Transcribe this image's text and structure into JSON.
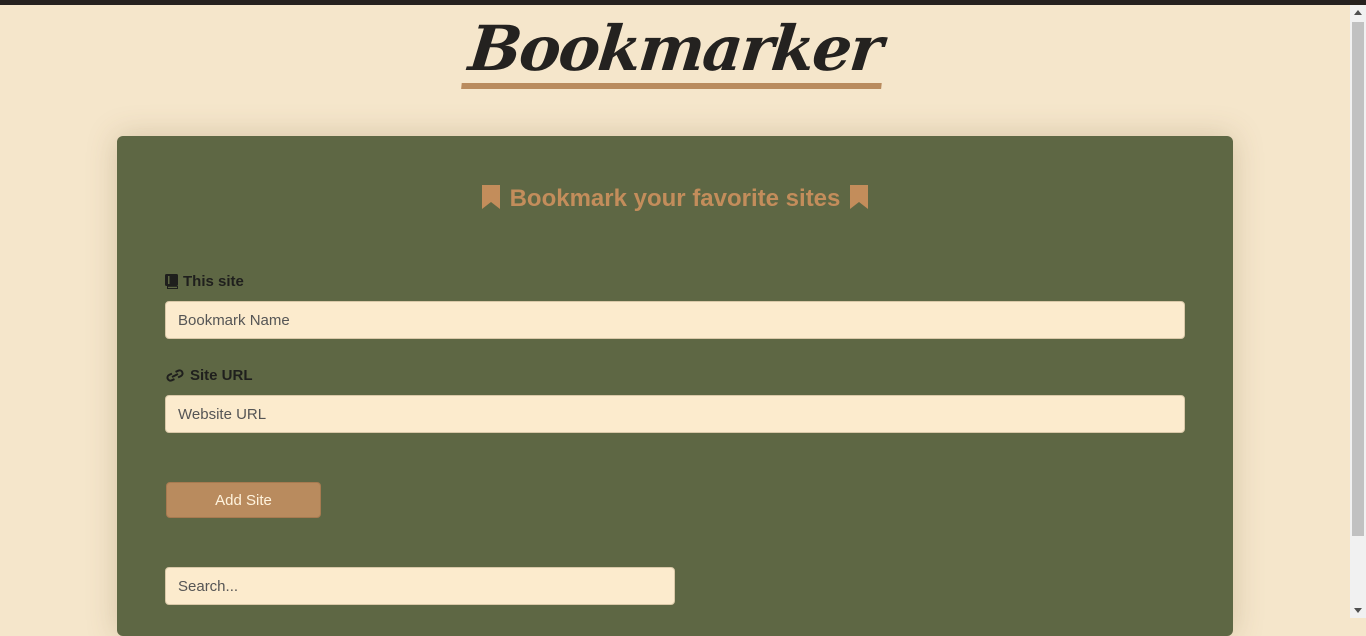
{
  "header": {
    "title": "Bookmarker"
  },
  "card": {
    "heading": "Bookmark your favorite sites",
    "name_field": {
      "label": "This site",
      "placeholder": "Bookmark Name",
      "value": ""
    },
    "url_field": {
      "label": "Site URL",
      "placeholder": "Website URL",
      "value": ""
    },
    "add_button_label": "Add Site",
    "search": {
      "placeholder": "Search...",
      "value": ""
    }
  },
  "icons": {
    "heading_left": "bookmark-icon",
    "heading_right": "bookmark-icon",
    "name_label": "book-icon",
    "url_label": "link-icon"
  },
  "colors": {
    "page_background": "#f5e6cb",
    "card_background": "#5e6744",
    "accent": "#b98b5e",
    "input_background": "#fcebcd",
    "title_text": "#242220"
  }
}
